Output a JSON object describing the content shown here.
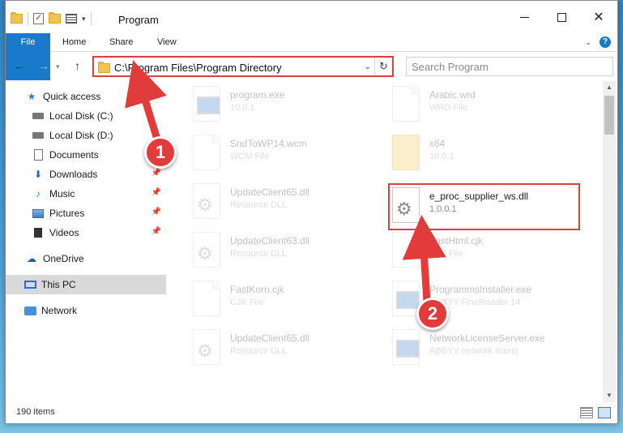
{
  "window": {
    "title": "Program"
  },
  "ribbon": {
    "tabs": [
      "File",
      "Home",
      "Share",
      "View"
    ]
  },
  "address": {
    "path": "C:\\Program Files\\Program Directory"
  },
  "search": {
    "placeholder": "Search Program"
  },
  "sidebar": {
    "items": [
      {
        "label": "Quick access",
        "icon": "star-icon"
      },
      {
        "label": "Local Disk (C:)",
        "icon": "drive-icon"
      },
      {
        "label": "Local Disk (D:)",
        "icon": "drive-icon"
      },
      {
        "label": "Documents",
        "icon": "documents-icon"
      },
      {
        "label": "Downloads",
        "icon": "downloads-icon",
        "pinned": true
      },
      {
        "label": "Music",
        "icon": "music-icon",
        "pinned": true
      },
      {
        "label": "Pictures",
        "icon": "pictures-icon",
        "pinned": true
      },
      {
        "label": "Videos",
        "icon": "videos-icon",
        "pinned": true
      },
      {
        "label": "OneDrive",
        "icon": "cloud-icon"
      },
      {
        "label": "This PC",
        "icon": "pc-icon",
        "selected": true
      },
      {
        "label": "Network",
        "icon": "network-icon"
      }
    ]
  },
  "files": [
    {
      "name": "program.exe",
      "sub": "10.0.1",
      "icon": "program-exe-icon",
      "faded": true
    },
    {
      "name": "Arabic.wrd",
      "sub": "WRD File",
      "icon": "blank-file-icon",
      "faded": true
    },
    {
      "name": "SndToWP14.wcm",
      "sub": "WCM File",
      "icon": "blank-file-icon",
      "faded": true
    },
    {
      "name": "x64",
      "sub": "10.0.1",
      "icon": "folder-icon",
      "faded": true
    },
    {
      "name": "UpdateClient65.dll",
      "sub": "Resource DLL",
      "icon": "dll-icon",
      "faded": true
    },
    {
      "name": "e_proc_supplier_ws.dll",
      "sub": "1.0.0.1",
      "icon": "dll-icon",
      "faded": false
    },
    {
      "name": "UpdateClient63.dll",
      "sub": "Resource DLL",
      "icon": "dll-icon",
      "faded": true
    },
    {
      "name": "FastHtml.cjk",
      "sub": "CJK File",
      "icon": "blank-file-icon",
      "faded": true
    },
    {
      "name": "FastKorn.cjk",
      "sub": "CJK File",
      "icon": "blank-file-icon",
      "faded": true
    },
    {
      "name": "ProgrammsInstaller.exe",
      "sub": "ABBYY FineReader 14",
      "icon": "installer-exe-icon",
      "faded": true
    },
    {
      "name": "UpdateClient65.dll",
      "sub": "Resource DLL",
      "icon": "dll-icon",
      "faded": true
    },
    {
      "name": "NetworkLicenseServer.exe",
      "sub": "ABBYY network licens",
      "icon": "installer-exe-icon",
      "faded": true
    }
  ],
  "status": {
    "item_count": "190 items"
  },
  "annotations": {
    "step1": "1",
    "step2": "2"
  },
  "colors": {
    "accent": "#1979ca",
    "highlight": "#d64343"
  }
}
